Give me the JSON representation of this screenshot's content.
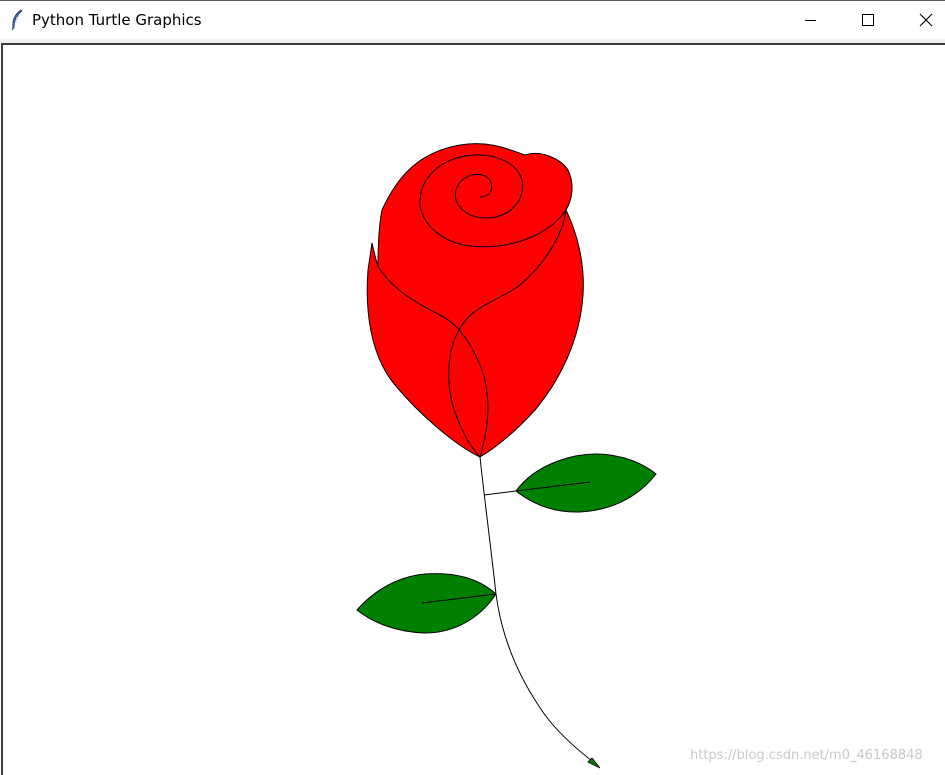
{
  "window": {
    "title": "Python Turtle Graphics",
    "icon": "feather-icon",
    "controls": {
      "minimize": "minimize-icon",
      "maximize": "maximize-icon",
      "close": "close-icon"
    }
  },
  "canvas": {
    "background": "#ffffff",
    "drawing": {
      "subject": "rose",
      "petal_color": "#ff0000",
      "leaf_color": "#008000",
      "outline_color": "#000000",
      "turtle_cursor": "arrow-turtle-icon"
    }
  },
  "watermark": {
    "text": "https://blog.csdn.net/m0_46168848"
  }
}
